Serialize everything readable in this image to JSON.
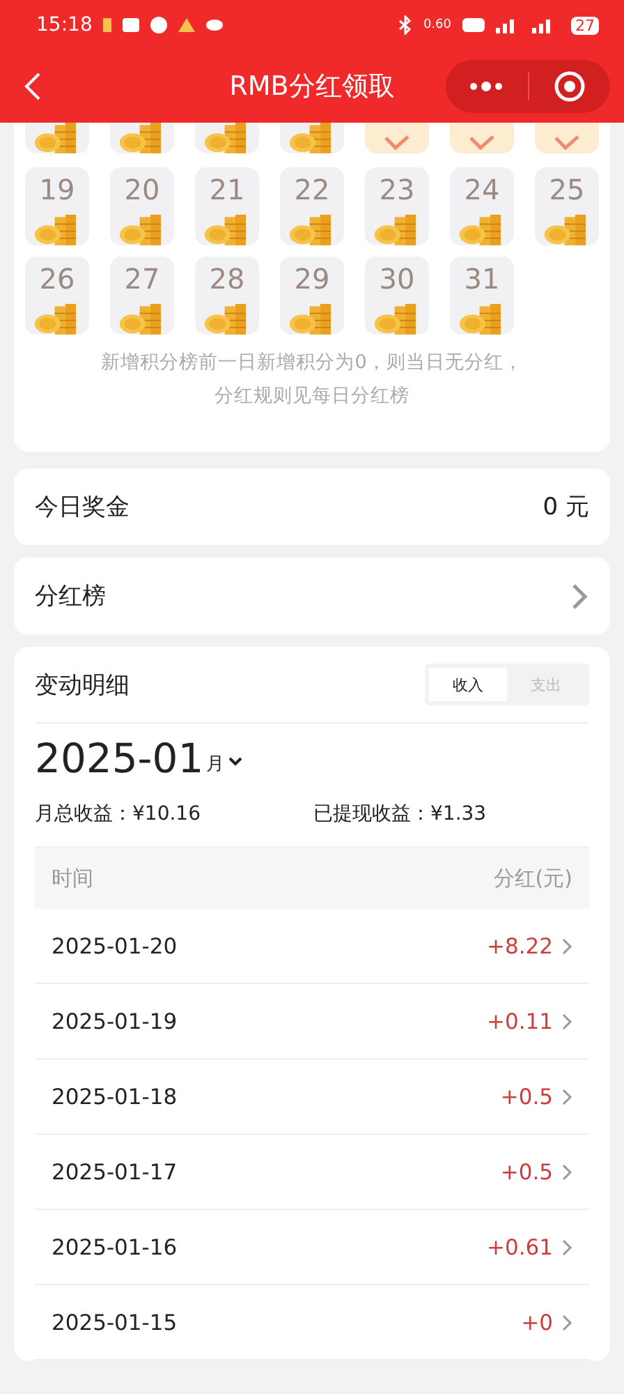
{
  "status_bar": {
    "time": "15:18",
    "network_speed": "0.60",
    "battery": "27"
  },
  "nav": {
    "title": "RMB分红领取"
  },
  "calendar": {
    "partial_row": [
      {
        "checked": false
      },
      {
        "checked": false
      },
      {
        "checked": false
      },
      {
        "checked": false
      },
      {
        "checked": true
      },
      {
        "checked": true
      },
      {
        "checked": true
      }
    ],
    "days": [
      {
        "day": "19",
        "checked": false
      },
      {
        "day": "20",
        "checked": false
      },
      {
        "day": "21",
        "checked": false
      },
      {
        "day": "22",
        "checked": false
      },
      {
        "day": "23",
        "checked": false
      },
      {
        "day": "24",
        "checked": false
      },
      {
        "day": "25",
        "checked": false
      },
      {
        "day": "26",
        "checked": false
      },
      {
        "day": "27",
        "checked": false
      },
      {
        "day": "28",
        "checked": false
      },
      {
        "day": "29",
        "checked": false
      },
      {
        "day": "30",
        "checked": false
      },
      {
        "day": "31",
        "checked": false
      }
    ],
    "note": [
      "新增积分榜前一日新增积分为0，则当日无分红，",
      "分红规则见每日分红榜"
    ]
  },
  "today_bonus": {
    "label": "今日奖金",
    "value": "0 元"
  },
  "ranking": {
    "label": "分红榜"
  },
  "details": {
    "title": "变动明细",
    "tabs": [
      {
        "label": "收入",
        "selected": true
      },
      {
        "label": "支出",
        "selected": false
      }
    ],
    "year_month": "2025-01",
    "month_unit": "月",
    "monthly_total": "月总收益：¥10.16",
    "withdrawn": "已提现收益：¥1.33",
    "columns": [
      "时间",
      "分红(元)"
    ],
    "rows": [
      {
        "date": "2025-01-20",
        "amount": "+8.22"
      },
      {
        "date": "2025-01-19",
        "amount": "+0.11"
      },
      {
        "date": "2025-01-18",
        "amount": "+0.5"
      },
      {
        "date": "2025-01-17",
        "amount": "+0.5"
      },
      {
        "date": "2025-01-16",
        "amount": "+0.61"
      },
      {
        "date": "2025-01-15",
        "amount": "+0"
      }
    ]
  }
}
